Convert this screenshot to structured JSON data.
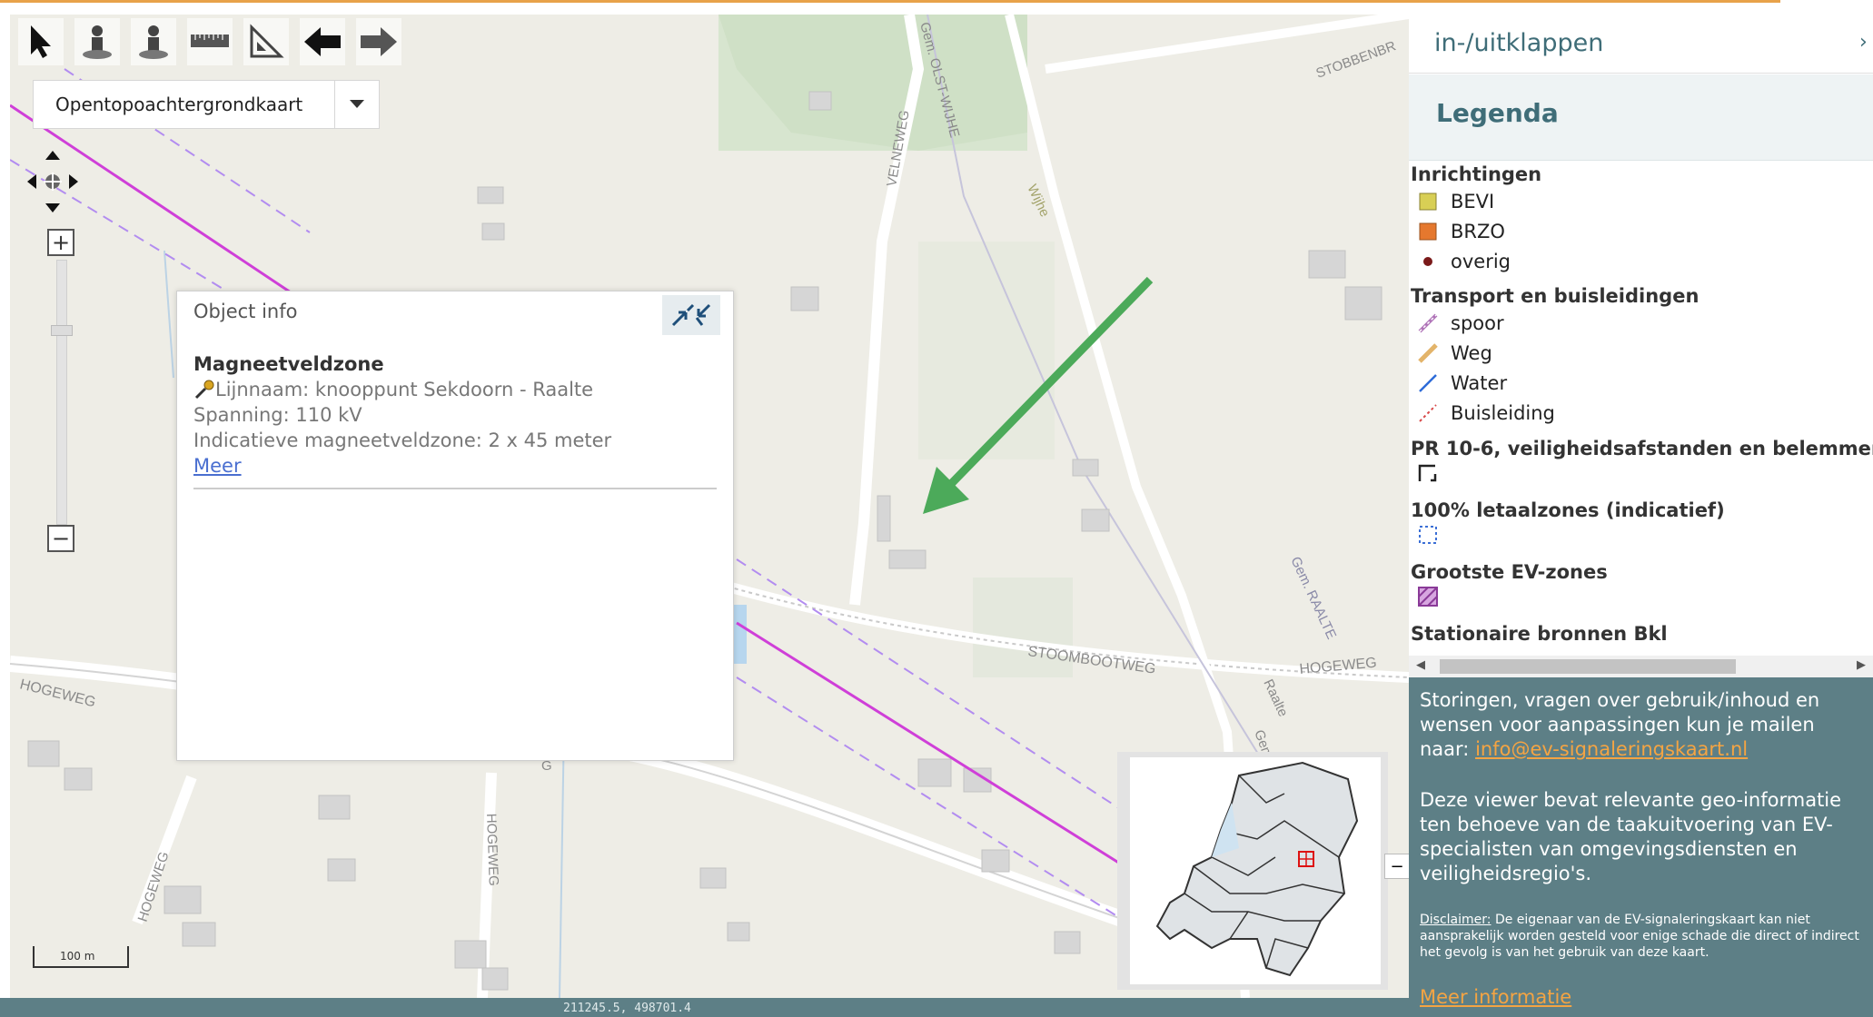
{
  "toolbar": {
    "tools": [
      "select-pointer-icon",
      "identify-person-icon",
      "identify-person-icon",
      "measure-ruler-icon",
      "measure-angle-icon",
      "back-arrow-icon",
      "forward-arrow-icon"
    ]
  },
  "basemap": {
    "selected": "Opentopoachtergrondkaart"
  },
  "map_labels": {
    "velneweg": "VELNEWEG",
    "olst_wijhe": "Gem. OLST-WIJHE",
    "stobbenbr": "STOBBENBR",
    "wijhe": "Wijhe",
    "raalte_gem": "Gem. RAALTE",
    "stoombootweg": "STOOMBOOTWEG",
    "hogeweg_right": "HOGEWEG",
    "raalte": "Raalte",
    "gem": "Gem",
    "hogeweg_left": "HOGEWEG",
    "hogeweg_v1": "HOGEWEG",
    "hogeweg_v2": "HOGEWEG",
    "g": "G"
  },
  "scalebar": {
    "label": "100 m"
  },
  "statusbar": {
    "coords": "211245.5, 498701.4"
  },
  "popup": {
    "title": "Object info",
    "heading": "Magneetveldzone",
    "line_name": "Lijnnaam: knooppunt Sekdoorn - Raalte",
    "voltage": "Spanning: 110 kV",
    "zone": "Indicatieve magneetveldzone: 2 x 45 meter",
    "more_link": "Meer"
  },
  "panel": {
    "toggle_label": "in-/uitklappen",
    "legend_title": "Legenda",
    "groups": {
      "inrichtingen": "Inrichtingen",
      "transport": "Transport en buisleidingen",
      "pr": "PR 10-6, veiligheidsafstanden en belemmer",
      "letaal": "100% letaalzones (indicatief)",
      "ev": "Grootste EV-zones",
      "bkl": "Stationaire bronnen Bkl"
    },
    "items": {
      "bevi": "BEVI",
      "brzo": "BRZO",
      "overig": "overig",
      "spoor": "spoor",
      "weg": "Weg",
      "water": "Water",
      "buisleiding": "Buisleiding"
    },
    "colors": {
      "bevi": "#d8cf55",
      "brzo": "#e5782e",
      "overig": "#7a1a1a",
      "water": "#2d6bd8",
      "ev": "#8a3a98",
      "letaal": "#3b6fd6"
    }
  },
  "info": {
    "p1_text": "Storingen, vragen over gebruik/inhoud en wensen voor aanpassingen kun je mailen naar: ",
    "email": "info@ev-signaleringskaart.nl",
    "p2": "Deze viewer bevat relevante geo-informatie ten behoeve van de taakuitvoering van EV-specialisten van omgevingsdiensten en veiligheidsregio's.",
    "disclaimer_label": "Disclaimer:",
    "disclaimer_text": " De eigenaar van de EV-signaleringskaart kan niet aansprakelijk worden gesteld voor enige schade die direct of indirect het gevolg is van het gebruik van deze kaart.",
    "more_info": "Meer informatie"
  }
}
